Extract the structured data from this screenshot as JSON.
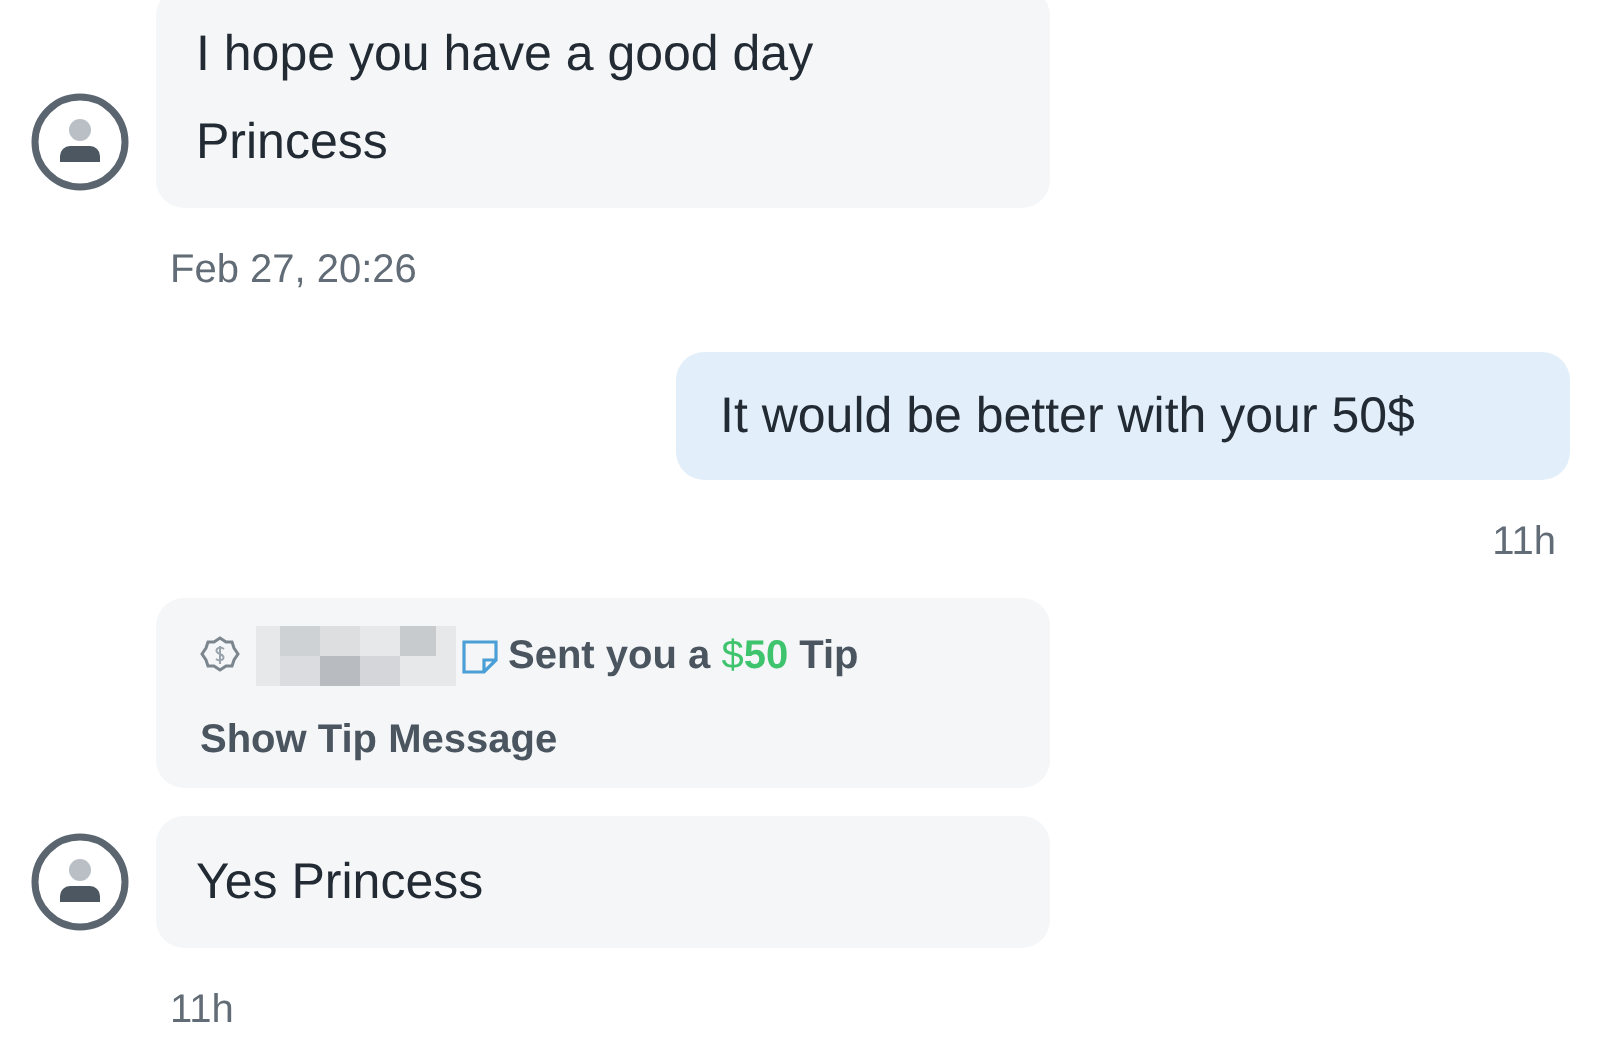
{
  "messages": [
    {
      "kind": "incoming",
      "text": "I hope you have a good day Princess"
    },
    {
      "kind": "received_time",
      "text": "Feb 27, 20:26"
    },
    {
      "kind": "outgoing",
      "text": "It would be better with your 50$"
    },
    {
      "kind": "sent_time",
      "text": "11h"
    },
    {
      "kind": "tip",
      "action": "Sent you a",
      "currency": "$",
      "amount": "50",
      "suffix": "Tip",
      "link": "Show Tip Message"
    },
    {
      "kind": "incoming",
      "text": "Yes Princess"
    },
    {
      "kind": "received_time",
      "text": "11h"
    }
  ]
}
